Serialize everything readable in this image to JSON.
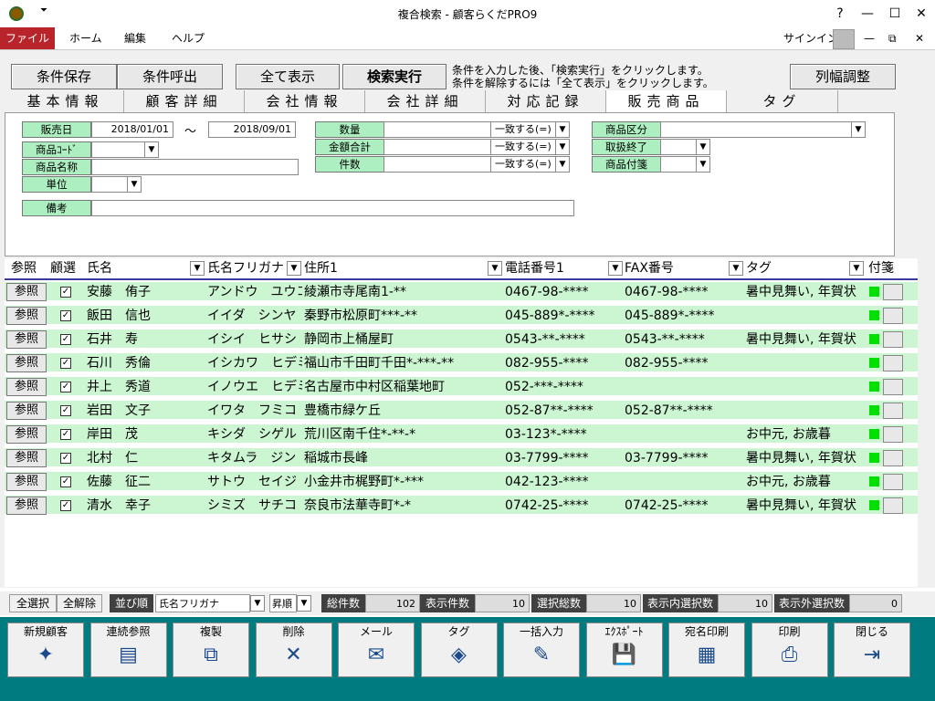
{
  "window": {
    "title": "複合検索 - 顧客らくだPRO9",
    "help": "?",
    "signin": "サインイン"
  },
  "menu": {
    "file": "ファイル",
    "home": "ホーム",
    "edit": "編集",
    "help": "ヘルプ"
  },
  "toolbar": {
    "save": "条件保存",
    "load": "条件呼出",
    "showall": "全て表示",
    "search": "検索実行",
    "hint1": "条件を入力した後、「検索実行」をクリックします。",
    "hint2": "条件を解除するには「全て表示」をクリックします。",
    "colfit": "列幅調整"
  },
  "tabs": [
    "基本情報",
    "顧客詳細",
    "会社情報",
    "会社詳細",
    "対応記録",
    "販売商品",
    "タグ"
  ],
  "form": {
    "date_label": "販売日",
    "date_from": "2018/01/01",
    "tilde": "～",
    "date_to": "2018/09/01",
    "code_label": "商品ｺｰﾄﾞ",
    "name_label": "商品名称",
    "unit_label": "単位",
    "note_label": "備考",
    "qty_label": "数量",
    "amount_label": "金額合計",
    "count_label": "件数",
    "match": "一致する(=)",
    "cat_label": "商品区分",
    "end_label": "取扱終了",
    "tag_label": "商品付箋"
  },
  "columns": {
    "ref": "参照",
    "select": "顧選",
    "name": "氏名",
    "kana": "氏名フリガナ",
    "address": "住所1",
    "tel": "電話番号1",
    "fax": "FAX番号",
    "tag": "タグ",
    "label": "付箋"
  },
  "rows": [
    {
      "ref": "参照",
      "name": "安藤　侑子",
      "kana": "アンドウ　ユウコ",
      "address": "綾瀬市寺尾南1-**",
      "tel": "0467-98-****",
      "fax": "0467-98-****",
      "tag": "暑中見舞い, 年賀状"
    },
    {
      "ref": "参照",
      "name": "飯田　信也",
      "kana": "イイダ　シンヤ",
      "address": "秦野市松原町***-**",
      "tel": "045-889*-****",
      "fax": "045-889*-****",
      "tag": ""
    },
    {
      "ref": "参照",
      "name": "石井　寿",
      "kana": "イシイ　ヒサシ",
      "address": "静岡市上桶屋町",
      "tel": "0543-**-****",
      "fax": "0543-**-****",
      "tag": "暑中見舞い, 年賀状"
    },
    {
      "ref": "参照",
      "name": "石川　秀倫",
      "kana": "イシカワ　ヒデミチ",
      "address": "福山市千田町千田*-***-**",
      "tel": "082-955-****",
      "fax": "082-955-****",
      "tag": ""
    },
    {
      "ref": "参照",
      "name": "井上　秀道",
      "kana": "イノウエ　ヒデミチ",
      "address": "名古屋市中村区稲葉地町",
      "tel": "052-***-****",
      "fax": "",
      "tag": ""
    },
    {
      "ref": "参照",
      "name": "岩田　文子",
      "kana": "イワタ　フミコ",
      "address": "豊橋市緑ケ丘",
      "tel": "052-87**-****",
      "fax": "052-87**-****",
      "tag": ""
    },
    {
      "ref": "参照",
      "name": "岸田　茂",
      "kana": "キシダ　シゲル",
      "address": "荒川区南千住*-**-*",
      "tel": "03-123*-****",
      "fax": "",
      "tag": "お中元, お歳暮"
    },
    {
      "ref": "参照",
      "name": "北村　仁",
      "kana": "キタムラ　ジン",
      "address": "稲城市長峰",
      "tel": "03-7799-****",
      "fax": "03-7799-****",
      "tag": "暑中見舞い, 年賀状"
    },
    {
      "ref": "参照",
      "name": "佐藤　征二",
      "kana": "サトウ　セイジ",
      "address": "小金井市梶野町*-***",
      "tel": "042-123-****",
      "fax": "",
      "tag": "お中元, お歳暮"
    },
    {
      "ref": "参照",
      "name": "清水　幸子",
      "kana": "シミズ　サチコ",
      "address": "奈良市法華寺町*-*",
      "tel": "0742-25-****",
      "fax": "0742-25-****",
      "tag": "暑中見舞い, 年賀状"
    }
  ],
  "status": {
    "selall": "全選択",
    "clear": "全解除",
    "sort_label": "並び順",
    "sort_value": "氏名フリガナ",
    "order": "昇順",
    "total_label": "総件数",
    "total": "102",
    "shown_label": "表示件数",
    "shown": "10",
    "selected_label": "選択総数",
    "selected": "10",
    "in_label": "表示内選択数",
    "in": "10",
    "out_label": "表示外選択数",
    "out": "0"
  },
  "buttons": [
    {
      "label": "新規顧客",
      "icon": "✦"
    },
    {
      "label": "連続参照",
      "icon": "▤"
    },
    {
      "label": "複製",
      "icon": "⧉"
    },
    {
      "label": "削除",
      "icon": "✕"
    },
    {
      "label": "メール",
      "icon": "✉"
    },
    {
      "label": "タグ",
      "icon": "◈"
    },
    {
      "label": "一括入力",
      "icon": "✎"
    },
    {
      "label": "ｴｸｽﾎﾟｰﾄ",
      "icon": "💾"
    },
    {
      "label": "宛名印刷",
      "icon": "▦"
    },
    {
      "label": "印刷",
      "icon": "⎙"
    },
    {
      "label": "閉じる",
      "icon": "⇥"
    }
  ]
}
